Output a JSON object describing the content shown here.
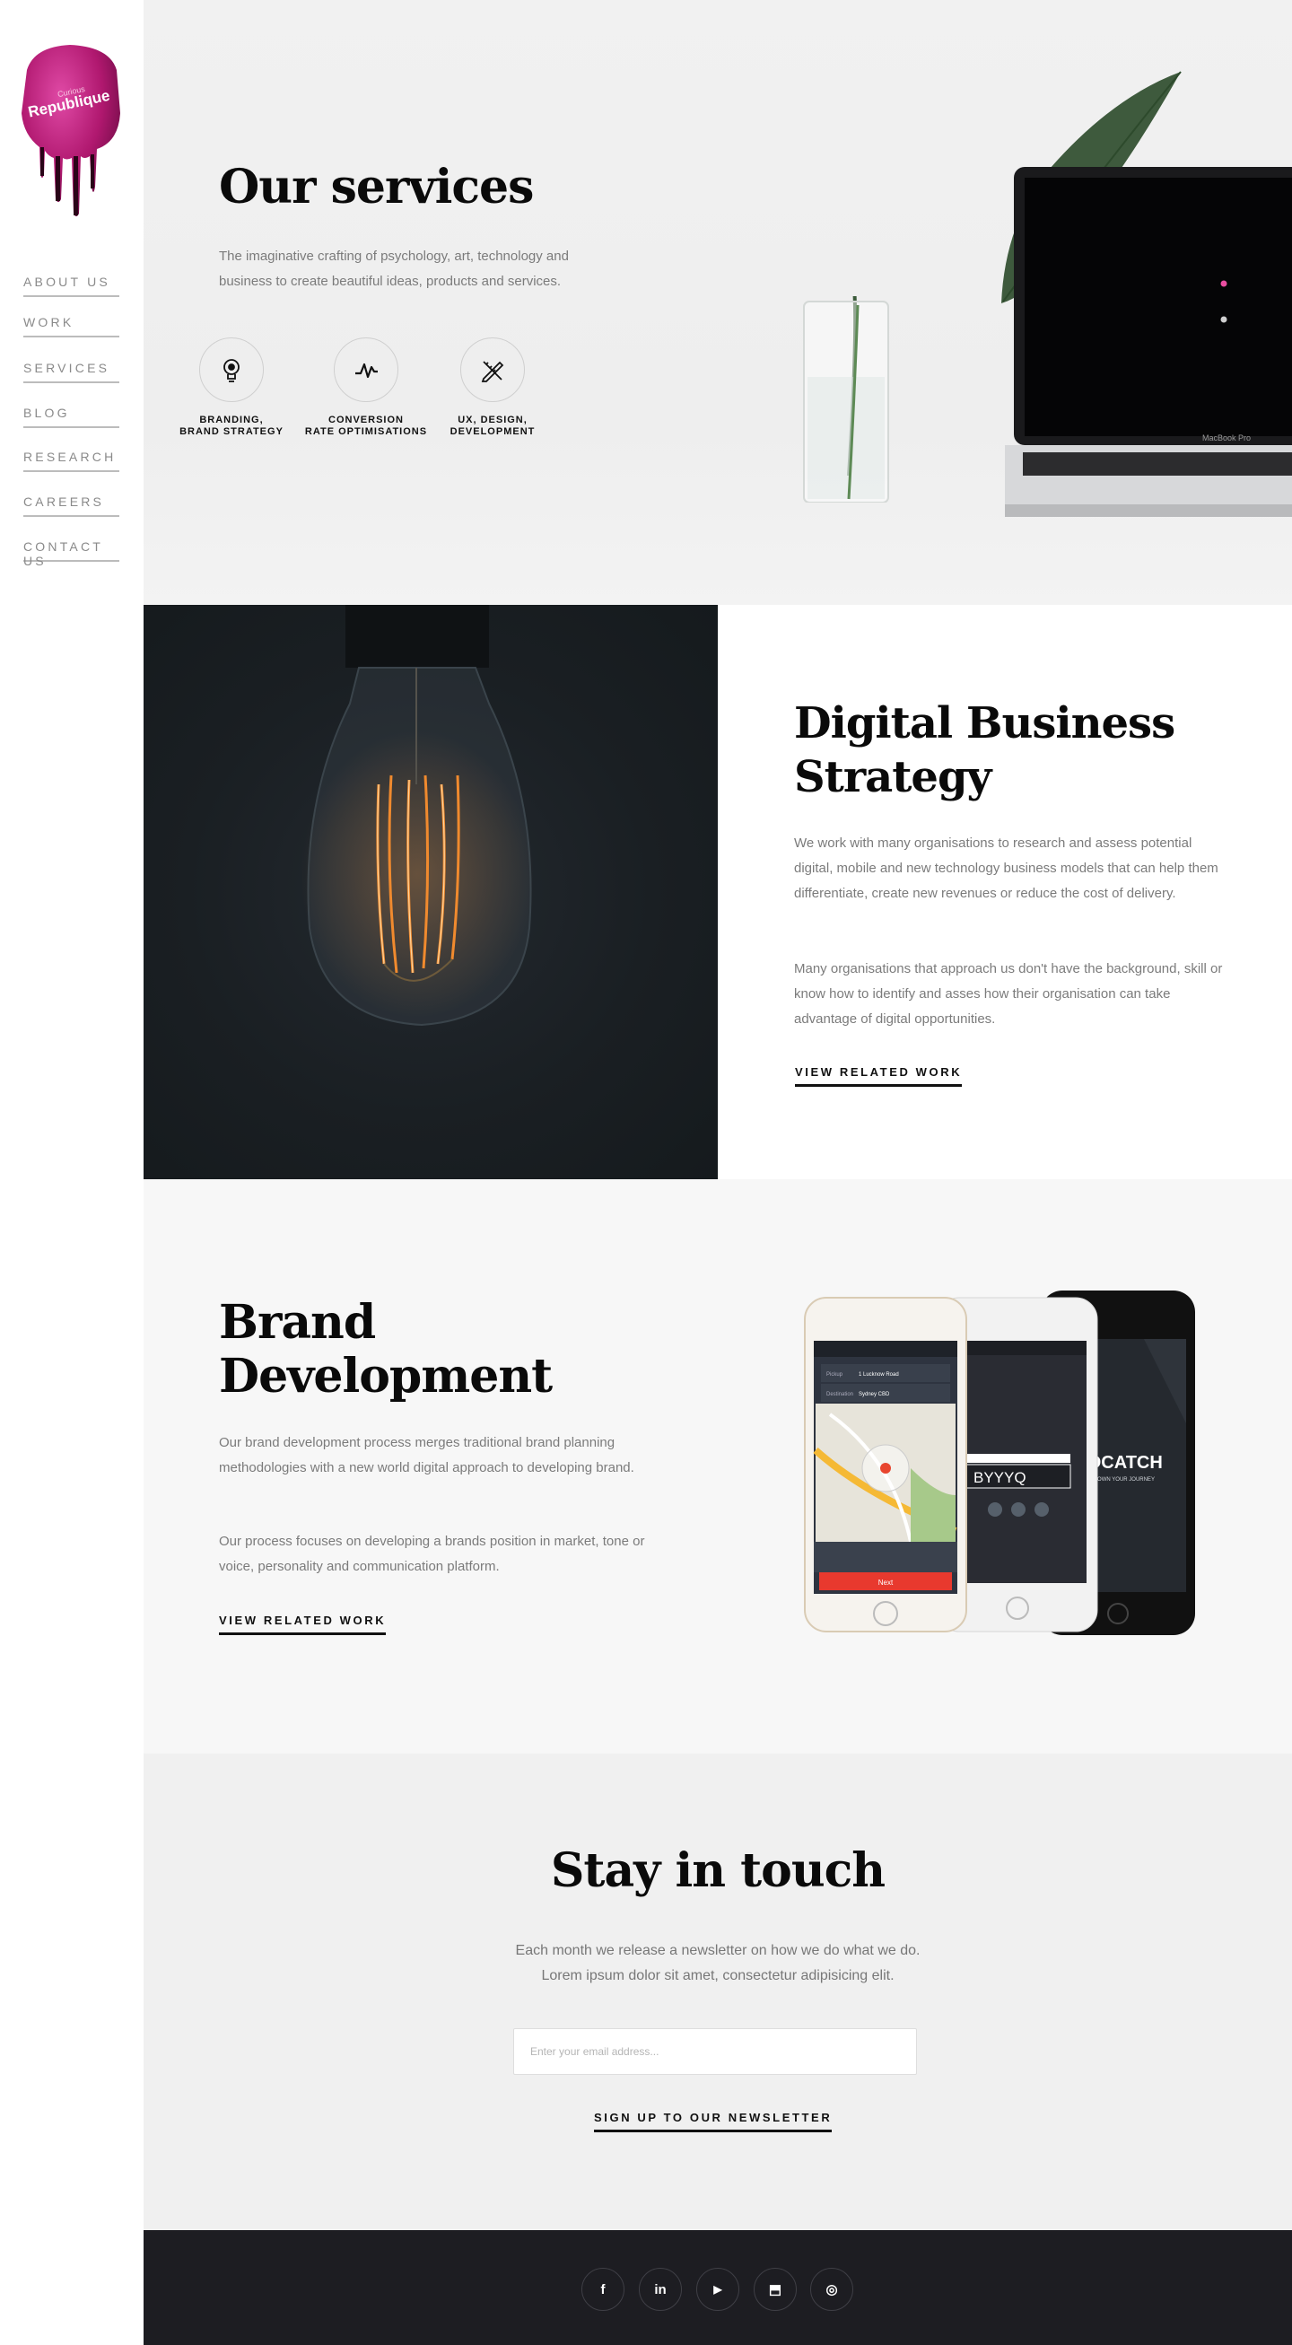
{
  "brand": {
    "logo_text_top": "Curious",
    "logo_text_main": "Republique"
  },
  "nav": {
    "items": [
      {
        "label": "ABOUT US"
      },
      {
        "label": "WORK"
      },
      {
        "label": "SERVICES"
      },
      {
        "label": "BLOG"
      },
      {
        "label": "RESEARCH"
      },
      {
        "label": "CAREERS"
      },
      {
        "label": "CONTACT US"
      }
    ]
  },
  "hero": {
    "title": "Our services",
    "subtitle": "The imaginative crafting of psychology, art, technology and business to create beautiful ideas, products and services.",
    "laptop_label": "MacBook Pro",
    "services": [
      {
        "icon": "lightbulb-icon",
        "line1": "BRANDING,",
        "line2": "BRAND STRATEGY"
      },
      {
        "icon": "pulse-icon",
        "line1": "CONVERSION",
        "line2": "RATE OPTIMISATIONS"
      },
      {
        "icon": "pencil-ruler-icon",
        "line1": "UX, DESIGN,",
        "line2": "DEVELOPMENT"
      }
    ]
  },
  "digital": {
    "title": "Digital Business Strategy",
    "para1": "We work with many organisations to research and assess potential digital, mobile and new technology business models that can help them differentiate, create new revenues or reduce the cost of delivery.",
    "para2": "Many organisations that approach us don't have the background, skill or know how to identify and asses how their organisation can take advantage of digital opportunities.",
    "link": "VIEW RELATED WORK"
  },
  "branddev": {
    "title": "Brand Development",
    "para1": "Our brand development process merges traditional brand planning methodologies with a new world digital approach to developing brand.",
    "para2": "Our process focuses on developing a brands position in market, tone or voice, personality and communication platform.",
    "link": "VIEW RELATED WORK",
    "app_name": "GOCATCH",
    "app_tagline": "OWN YOUR JOURNEY",
    "app_code": "BYYYQ",
    "app_pickup_label": "Pickup",
    "app_pickup_value": "1 Lucknow Road",
    "app_dest_label": "Destination",
    "app_dest_value": "Sydney CBD",
    "app_next": "Next"
  },
  "newsletter": {
    "title": "Stay in touch",
    "text": "Each month we release a newsletter on how we do what we do. Lorem ipsum dolor sit amet, consectetur adipisicing elit.",
    "placeholder": "Enter your email address...",
    "button": "SIGN UP TO OUR NEWSLETTER"
  },
  "footer": {
    "social": [
      {
        "icon": "facebook-icon",
        "glyph": "f"
      },
      {
        "icon": "linkedin-icon",
        "glyph": "in"
      },
      {
        "icon": "youtube-icon",
        "glyph": "▶"
      },
      {
        "icon": "pin-icon",
        "glyph": "⬒"
      },
      {
        "icon": "instagram-icon",
        "glyph": "◎"
      }
    ]
  },
  "colors": {
    "accent": "#c6207f",
    "dark": "#1d1d22",
    "text_muted": "#7b7b7b"
  }
}
